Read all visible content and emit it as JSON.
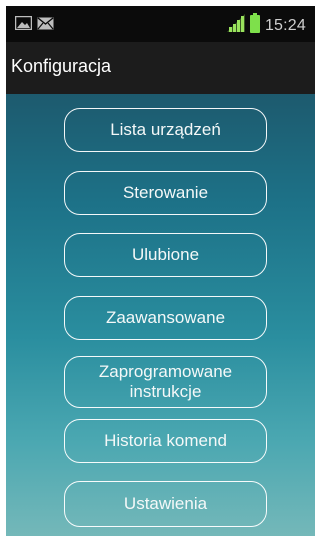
{
  "status_bar": {
    "left_icons": [
      "image-icon",
      "mail-icon"
    ],
    "right_icons": [
      "signal-icon",
      "battery-icon"
    ],
    "time": "15:24",
    "battery_color": "#7ee04b"
  },
  "action_bar": {
    "title": "Konfiguracja"
  },
  "menu": {
    "items": [
      {
        "label": "Lista urządzeń"
      },
      {
        "label": "Sterowanie"
      },
      {
        "label": "Ulubione"
      },
      {
        "label": "Zaawansowane"
      },
      {
        "label": "Zaprogramowane instrukcje"
      },
      {
        "label": "Historia komend"
      },
      {
        "label": "Ustawienia"
      }
    ]
  },
  "colors": {
    "status_bar_bg": "#0b0b0b",
    "action_bar_bg": "#1c1c1c",
    "gradient_top": "#1d5a6e",
    "gradient_bottom": "#74b8b9"
  }
}
